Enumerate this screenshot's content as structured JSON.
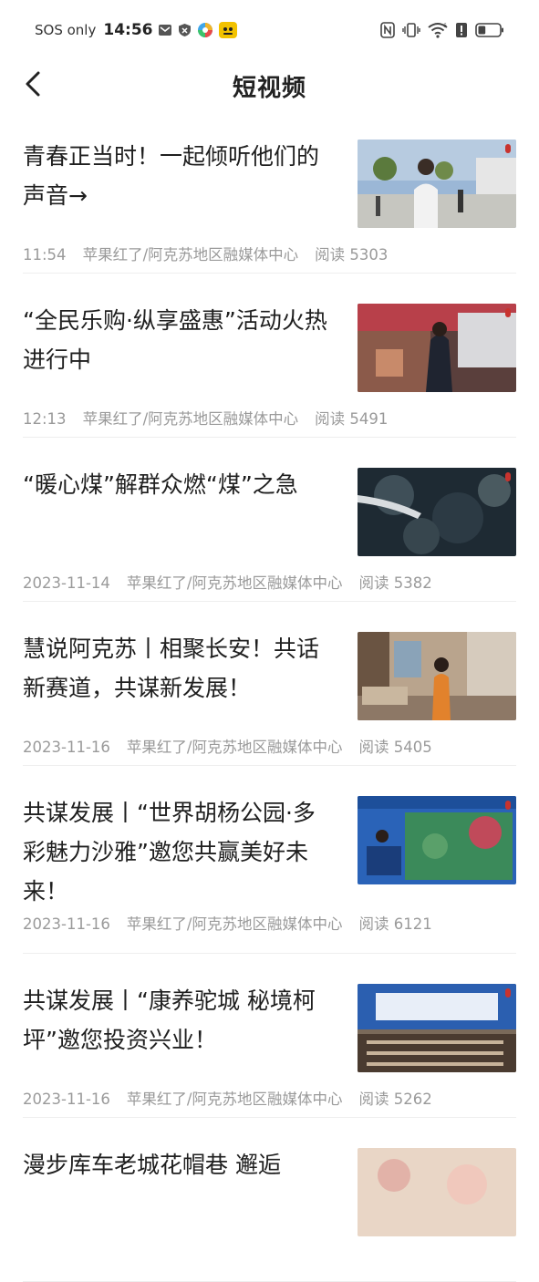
{
  "status_bar": {
    "carrier": "SOS only",
    "time": "14:56",
    "battery_level": 0.35
  },
  "nav": {
    "title": "短视频"
  },
  "articles": [
    {
      "title": "青春正当时！一起倾听他们的声音→",
      "time": "11:54",
      "source": "苹果红了/阿克苏地区融媒体中心",
      "reads": "阅读 5303"
    },
    {
      "title": "“全民乐购·纵享盛惠”活动火热进行中",
      "time": "12:13",
      "source": "苹果红了/阿克苏地区融媒体中心",
      "reads": "阅读 5491"
    },
    {
      "title": "“暖心煤”解群众燃“煤”之急",
      "time": "2023-11-14",
      "source": "苹果红了/阿克苏地区融媒体中心",
      "reads": "阅读 5382"
    },
    {
      "title": "慧说阿克苏丨相聚长安！共话新赛道，共谋新发展！",
      "time": "2023-11-16",
      "source": "苹果红了/阿克苏地区融媒体中心",
      "reads": "阅读 5405"
    },
    {
      "title": "共谋发展丨“世界胡杨公园·多彩魅力沙雅”邀您共赢美好未来！",
      "time": "2023-11-16",
      "source": "苹果红了/阿克苏地区融媒体中心",
      "reads": "阅读 6121"
    },
    {
      "title": "共谋发展丨“康养驼城 秘境柯坪”邀您投资兴业！",
      "time": "2023-11-16",
      "source": "苹果红了/阿克苏地区融媒体中心",
      "reads": "阅读 5262"
    },
    {
      "title": "漫步库车老城花帽巷 邂逅",
      "time": "",
      "source": "",
      "reads": ""
    }
  ]
}
